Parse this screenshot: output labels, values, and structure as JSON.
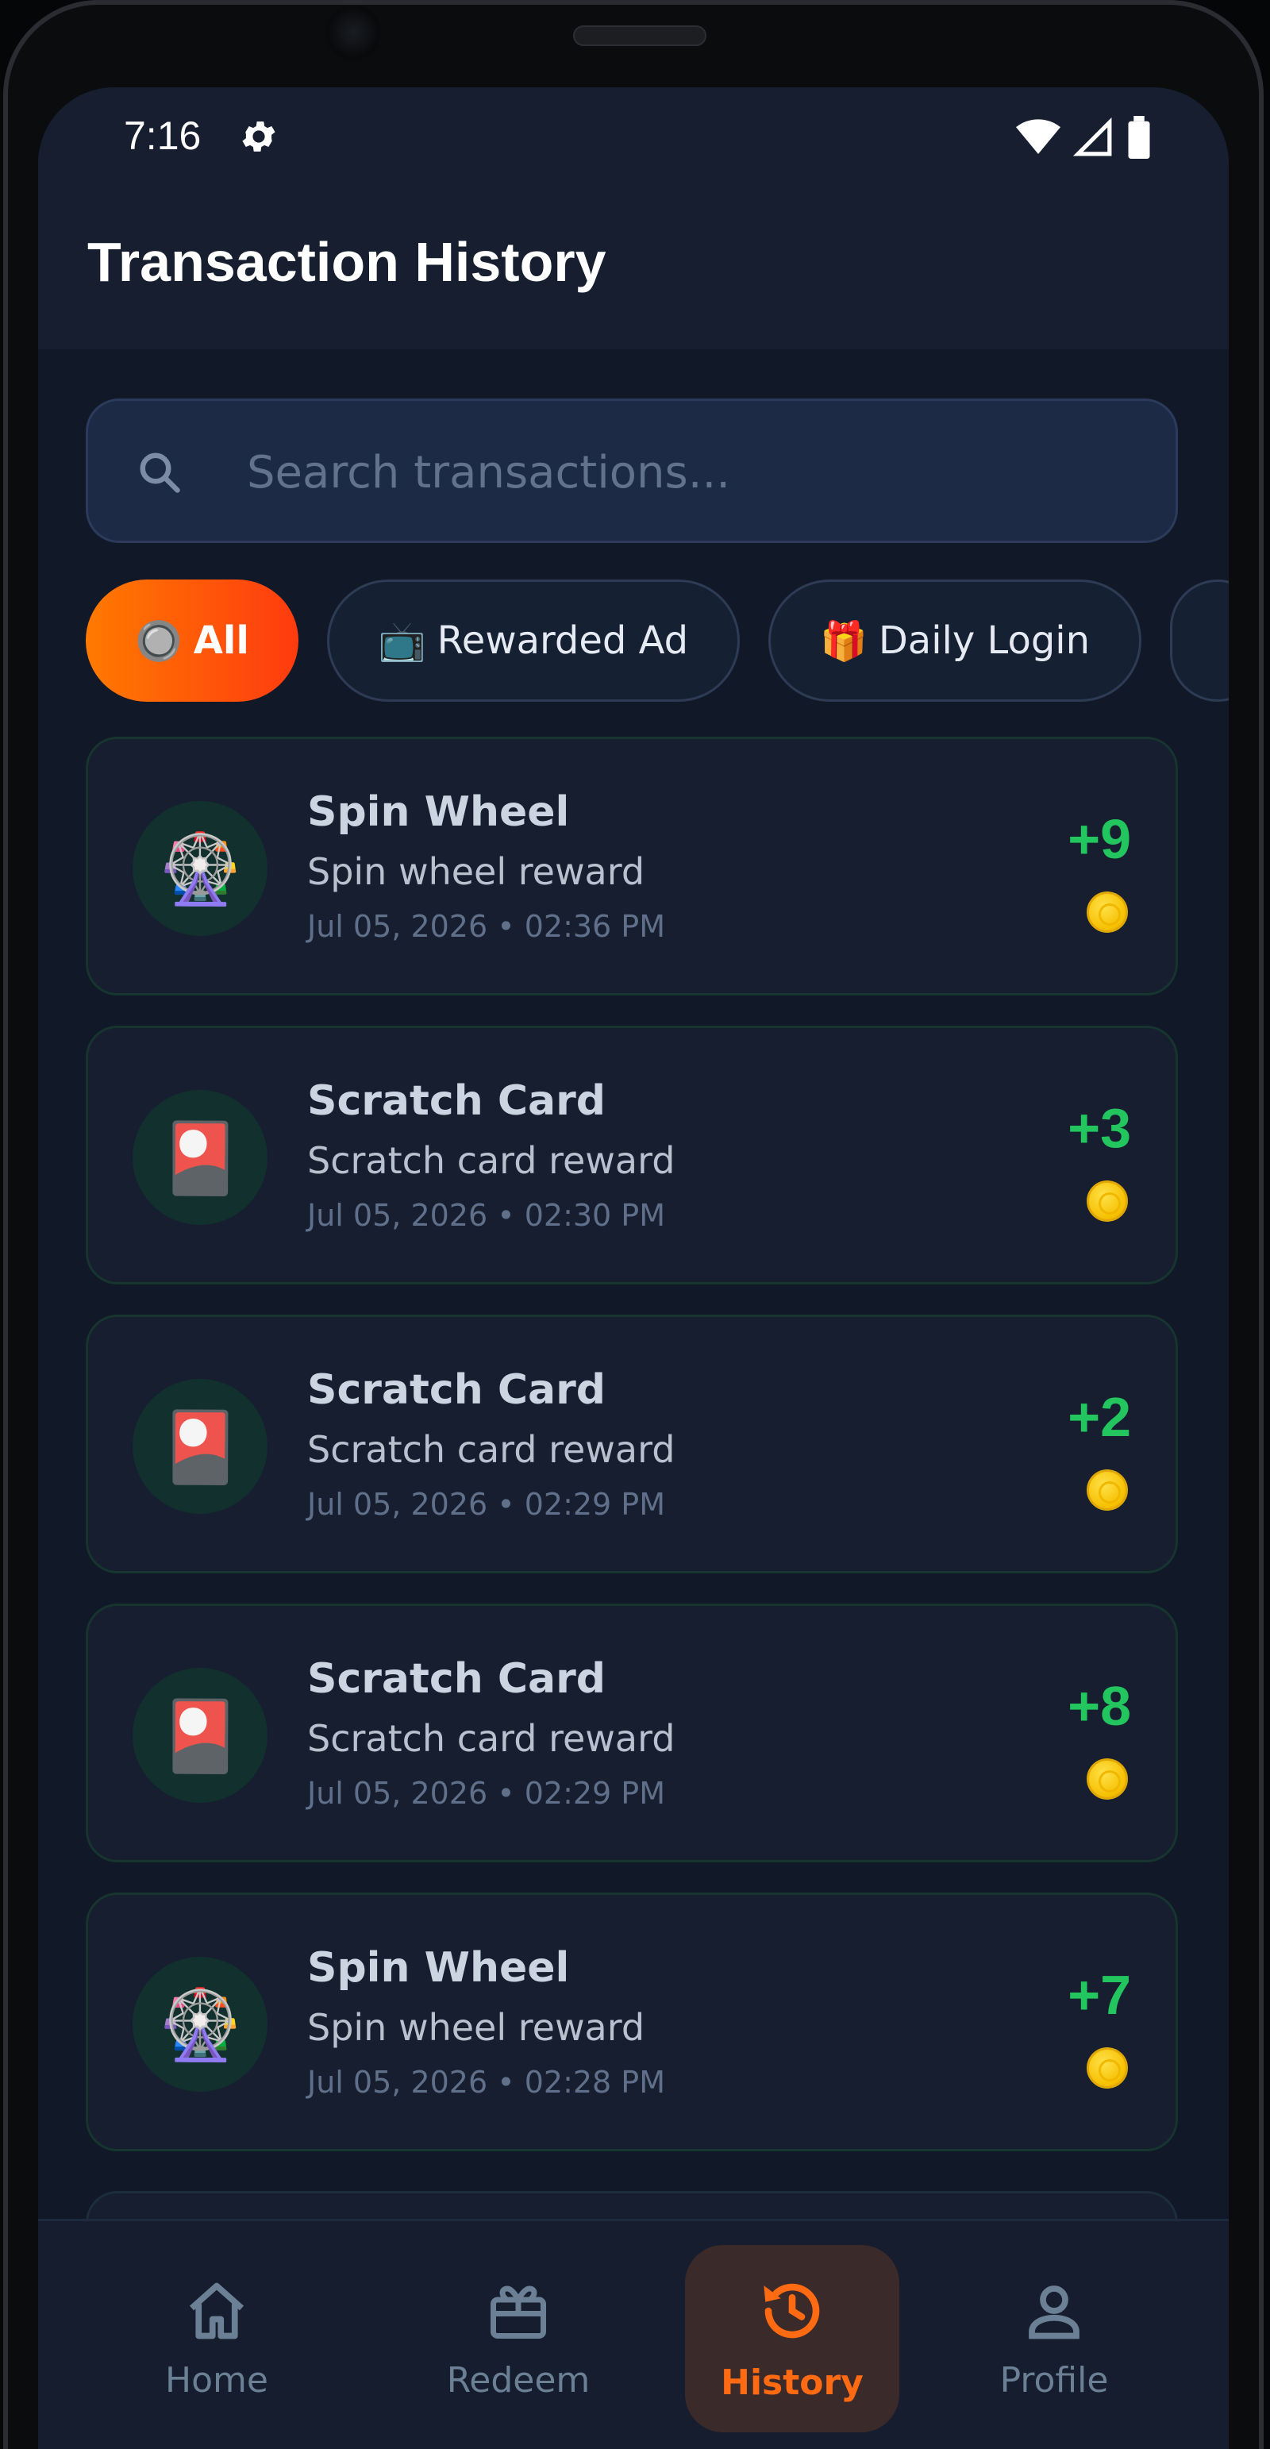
{
  "status_bar": {
    "time": "7:16"
  },
  "app_bar": {
    "title": "Transaction History"
  },
  "search": {
    "placeholder": "Search transactions..."
  },
  "filters": [
    {
      "emoji": "🔘",
      "label": "All",
      "active": true
    },
    {
      "emoji": "📺",
      "label": "Rewarded Ad",
      "active": false
    },
    {
      "emoji": "🎁",
      "label": "Daily Login",
      "active": false
    }
  ],
  "transactions": [
    {
      "icon": "🎡",
      "title": "Spin Wheel",
      "description": "Spin wheel reward",
      "date": "Jul 05, 2026 • 02:36 PM",
      "amount": "+9"
    },
    {
      "icon": "🎴",
      "title": "Scratch Card",
      "description": "Scratch card reward",
      "date": "Jul 05, 2026 • 02:30 PM",
      "amount": "+3"
    },
    {
      "icon": "🎴",
      "title": "Scratch Card",
      "description": "Scratch card reward",
      "date": "Jul 05, 2026 • 02:29 PM",
      "amount": "+2"
    },
    {
      "icon": "🎴",
      "title": "Scratch Card",
      "description": "Scratch card reward",
      "date": "Jul 05, 2026 • 02:29 PM",
      "amount": "+8"
    },
    {
      "icon": "🎡",
      "title": "Spin Wheel",
      "description": "Spin wheel reward",
      "date": "Jul 05, 2026 • 02:28 PM",
      "amount": "+7"
    }
  ],
  "bottom_nav": [
    {
      "label": "Home",
      "icon": "home-icon",
      "active": false
    },
    {
      "label": "Redeem",
      "icon": "gift-icon",
      "active": false
    },
    {
      "label": "History",
      "icon": "history-icon",
      "active": true
    },
    {
      "label": "Profile",
      "icon": "profile-icon",
      "active": false
    }
  ],
  "colors": {
    "accent": "#ff6a13",
    "positive": "#22c55e",
    "background": "#111827",
    "card": "#161e2f"
  }
}
